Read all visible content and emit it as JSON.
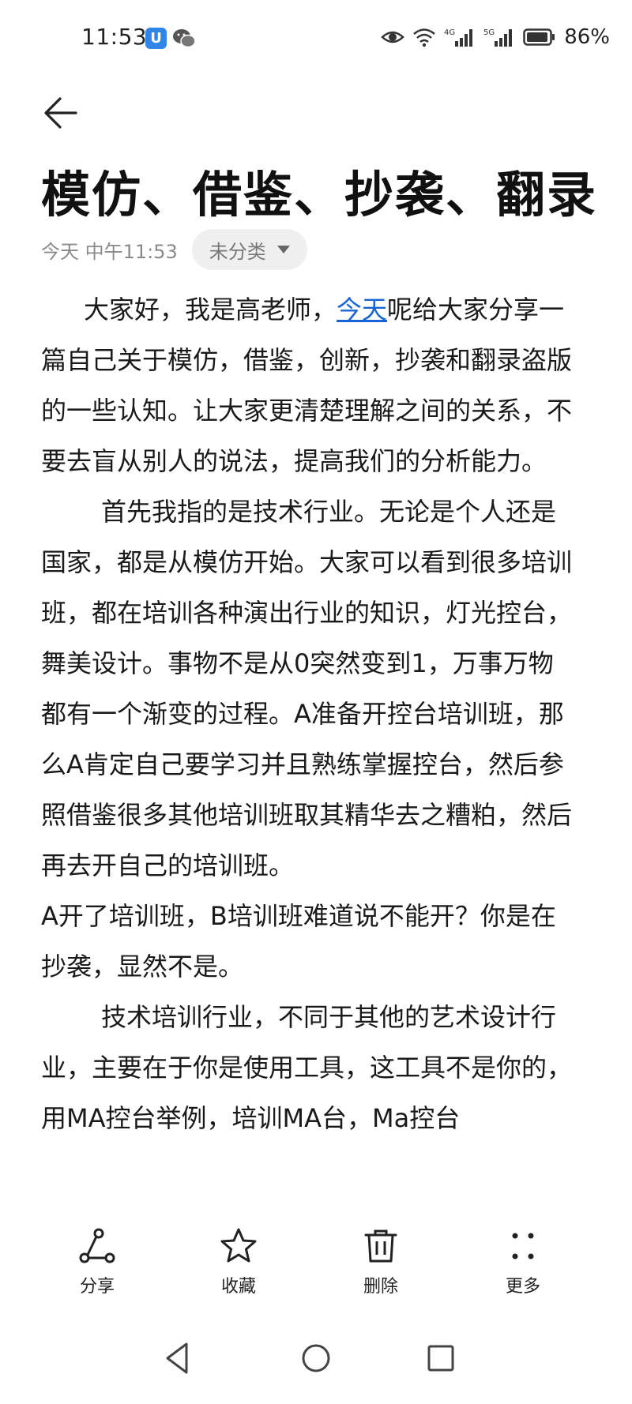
{
  "status_bar": {
    "time": "11:53",
    "battery": "86%",
    "network_1": "4G",
    "network_2": "5G",
    "app_icon_1": "U",
    "icons": [
      "app-notification-icon",
      "wechat-icon",
      "eye-icon",
      "wifi-icon",
      "signal-4g-icon",
      "signal-5g-icon",
      "battery-icon"
    ]
  },
  "note": {
    "title": "模仿、借鉴、抄袭、翻录",
    "date": "今天 中午11:53",
    "category": "未分类",
    "p1_before_link": "大家好，我是高老师，",
    "p1_link": "今天",
    "p1_after_link": "呢给大家分享一篇自己关于模仿，借鉴，创新，抄袭和翻录盗版的一些认知。让大家更清楚理解之间的关系，不要去盲从别人的说法，提高我们的分析能力。",
    "p2": "首先我指的是技术行业。无论是个人还是国家，都是从模仿开始。大家可以看到很多培训班，都在培训各种演出行业的知识，灯光控台，舞美设计。事物不是从0突然变到1，万事万物都有一个渐变的过程。A准备开控台培训班，那么A肯定自己要学习并且熟练掌握控台，然后参照借鉴很多其他培训班取其精华去之糟粕，然后再去开自己的培训班。",
    "p3": "A开了培训班，B培训班难道说不能开？你是在抄袭，显然不是。",
    "p4": "技术培训行业，不同于其他的艺术设计行业，主要在于你是使用工具，这工具不是你的，用MA控台举例，培训MA台，Ma控台"
  },
  "toolbar": {
    "share": "分享",
    "favorite": "收藏",
    "delete": "删除",
    "more": "更多"
  },
  "colors": {
    "link": "#1565d8",
    "chip_bg": "#efefef",
    "meta_text": "#8a8a8a"
  }
}
